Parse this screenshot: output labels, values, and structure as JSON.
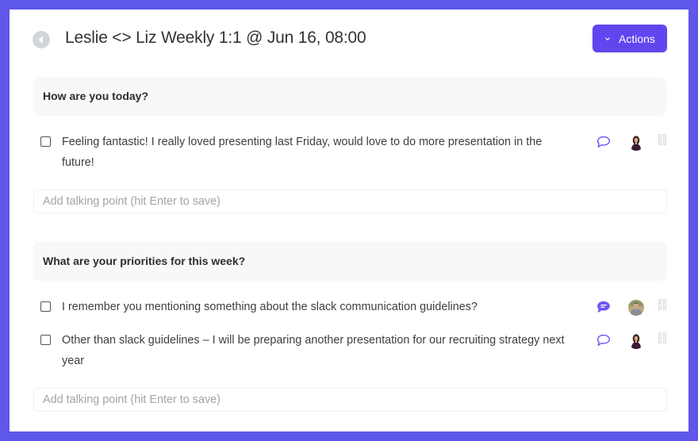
{
  "header": {
    "title": "Leslie <> Liz Weekly 1:1 @ Jun 16, 08:00",
    "back_icon": "back-arrow-circle-icon",
    "actions_label": "Actions",
    "actions_icon": "chevron-down-icon"
  },
  "colors": {
    "frame": "#5f57e8",
    "accent": "#6146f0",
    "comment_icon": "#6e58f5",
    "section_bg": "#f7f8fa"
  },
  "sections": [
    {
      "title": "How are you today?",
      "items": [
        {
          "text": "Feeling fantastic! I really loved presenting last Friday, would love to do more presentation in the future!",
          "checked": false,
          "comment_icon": "comment-outline-icon",
          "has_comments": false,
          "avatar": "woman-avatar"
        }
      ],
      "add_placeholder": "Add talking point (hit Enter to save)"
    },
    {
      "title": "What are your priorities for this week?",
      "items": [
        {
          "text": "I remember you mentioning something about the slack communication guidelines?",
          "checked": false,
          "comment_icon": "comment-filled-icon",
          "has_comments": true,
          "avatar": "man-avatar"
        },
        {
          "text": "Other than slack guidelines – I will be preparing another presentation for our recruiting strategy next year",
          "checked": false,
          "comment_icon": "comment-outline-icon",
          "has_comments": false,
          "avatar": "woman-avatar"
        }
      ],
      "add_placeholder": "Add talking point (hit Enter to save)"
    }
  ]
}
